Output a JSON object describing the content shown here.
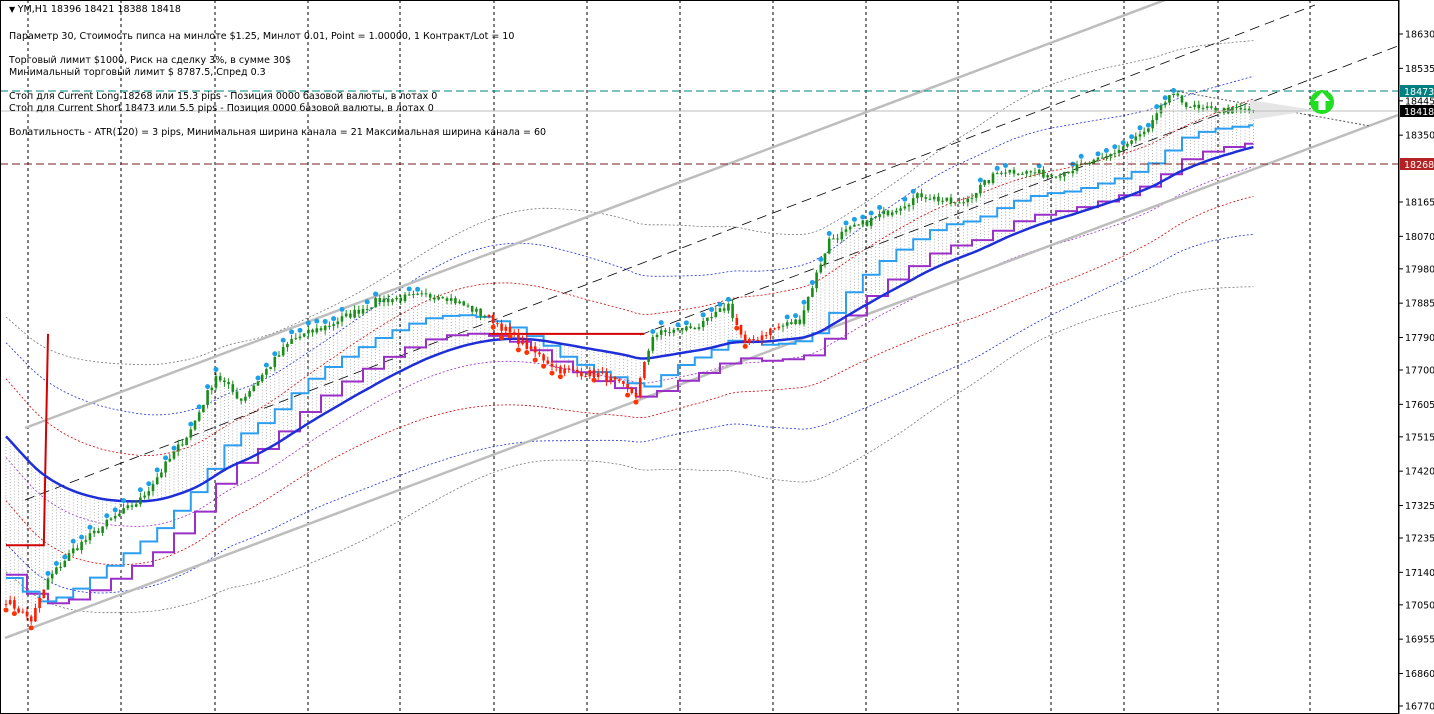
{
  "header": {
    "symbol_line": "YM,H1  18396 18421 18388 18418",
    "param_line": "Параметр 30,  Стоимость пипса на минлоте  $1.25,   Минлот 0.01,  Point = 1.00000,  1 Контракт/Lot = 10",
    "limit_line": "Торговый лимит $1000, Риск на сделку 3%,  в сумме 30$",
    "min_limit_line": "Минимальный торговый лимит $ 8787.5,   Спред  0.3",
    "stop_long_line": "Стоп для Current Long  18268  или  15.3 pips -  Позиция 0000 базовой валюты,  в лотах 0",
    "stop_short_line": "Стоп для Current Short 18473  или  5.5 pips -  Позиция 0000 базовой валюты,  в лотах 0",
    "volatility_line": "Волатильность - ATR(120) = 3 pips,  Минимальная ширина канала = 21    Максимальная ширина канала = 60"
  },
  "price_markers": {
    "stop_short": {
      "label": "18473",
      "value": 18473,
      "color": "#008080"
    },
    "bid": {
      "label": "18418",
      "value": 18418,
      "color": "#000000"
    },
    "stop_long": {
      "label": "18268",
      "value": 18268,
      "color": "#c0282d"
    }
  },
  "colors": {
    "up": "#1a8c1a",
    "down": "#ff1a00",
    "ma": "#1e2ed8",
    "fast": "#2b9ef0",
    "slow": "#9b30c8",
    "signal": "#d40000",
    "channel": "#b8b8b8"
  },
  "chart_data": {
    "type": "candlestick",
    "title": "YM,H1",
    "ylim": [
      16770,
      18630
    ],
    "y_ticks": [
      "18630",
      "18535",
      "18445",
      "18350",
      "18165",
      "18070",
      "17980",
      "17885",
      "17790",
      "17700",
      "17605",
      "17515",
      "17420",
      "17325",
      "17235",
      "17140",
      "17050",
      "16955",
      "16860",
      "16770"
    ],
    "bars": 298,
    "waypoints": [
      [
        0,
        17063
      ],
      [
        6,
        17008
      ],
      [
        10,
        17119
      ],
      [
        16,
        17202
      ],
      [
        25,
        17285
      ],
      [
        32,
        17340
      ],
      [
        44,
        17534
      ],
      [
        50,
        17686
      ],
      [
        56,
        17617
      ],
      [
        68,
        17783
      ],
      [
        77,
        17825
      ],
      [
        89,
        17894
      ],
      [
        104,
        17908
      ],
      [
        116,
        17838
      ],
      [
        125,
        17755
      ],
      [
        132,
        17700
      ],
      [
        142,
        17686
      ],
      [
        150,
        17631
      ],
      [
        154,
        17797
      ],
      [
        166,
        17825
      ],
      [
        172,
        17880
      ],
      [
        176,
        17769
      ],
      [
        182,
        17811
      ],
      [
        189,
        17838
      ],
      [
        196,
        18060
      ],
      [
        206,
        18115
      ],
      [
        218,
        18185
      ],
      [
        227,
        18157
      ],
      [
        237,
        18254
      ],
      [
        249,
        18240
      ],
      [
        261,
        18281
      ],
      [
        272,
        18364
      ],
      [
        277,
        18461
      ],
      [
        284,
        18420
      ],
      [
        297,
        18418
      ]
    ],
    "down_ranges": [
      [
        0,
        9
      ],
      [
        115,
        152
      ],
      [
        174,
        184
      ]
    ]
  }
}
